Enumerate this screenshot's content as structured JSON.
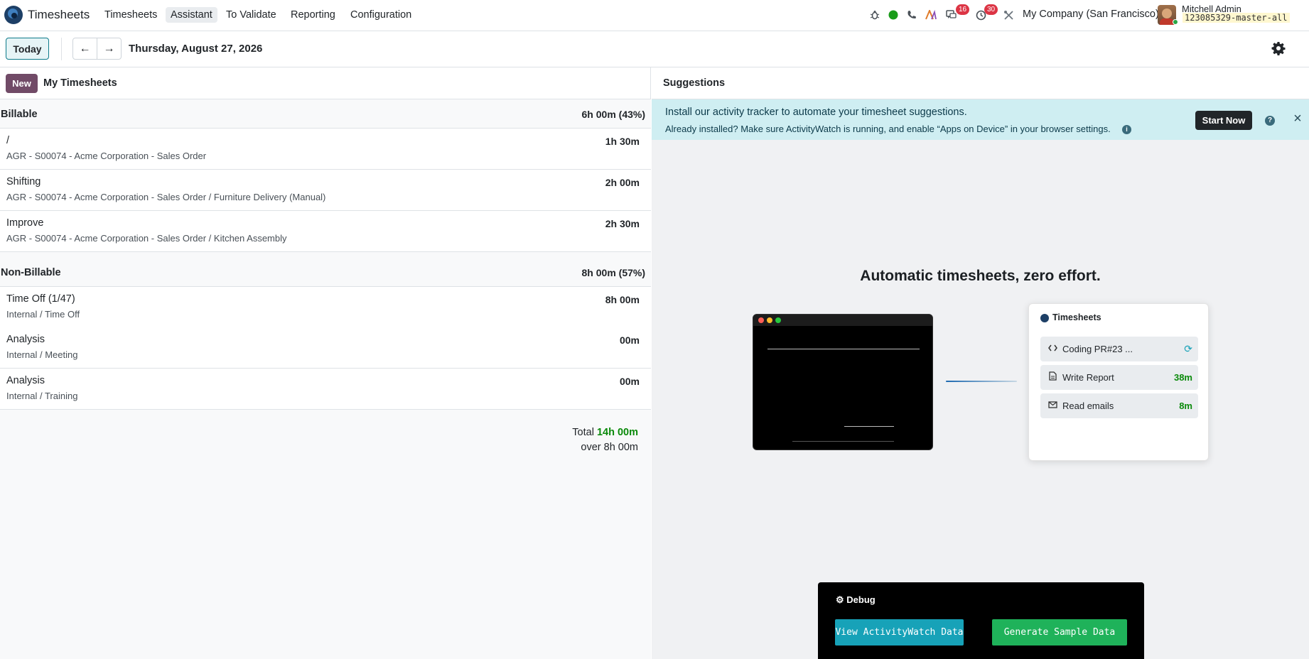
{
  "topbar": {
    "app_title": "Timesheets",
    "menu": [
      "Timesheets",
      "Assistant",
      "To Validate",
      "Reporting",
      "Configuration"
    ],
    "active_menu": "Assistant",
    "messages_count": "16",
    "activities_count": "30",
    "company": "My Company (San Francisco)",
    "user_name": "Mitchell Admin",
    "db_name": "123085329-master-all"
  },
  "controls": {
    "today_label": "Today",
    "prev_arrow": "←",
    "next_arrow": "→",
    "date": "Thursday, August 27, 2026"
  },
  "left": {
    "new_label": "New",
    "title": "My Timesheets",
    "groups": [
      {
        "label": "Billable",
        "total": "6h 00m (43%)",
        "rows": [
          {
            "title": "/",
            "sub": "AGR - S00074 - Acme Corporation - Sales Order",
            "time": "1h 30m"
          },
          {
            "title": "Shifting",
            "sub": "AGR - S00074 - Acme Corporation - Sales Order / Furniture Delivery (Manual)",
            "time": "2h 00m"
          },
          {
            "title": "Improve",
            "sub": "AGR - S00074 - Acme Corporation - Sales Order / Kitchen Assembly",
            "time": "2h 30m"
          }
        ]
      },
      {
        "label": "Non-Billable",
        "total": "8h 00m (57%)",
        "rows": [
          {
            "title": "Time Off (1/47)",
            "sub": "Internal / Time Off",
            "time": "8h 00m"
          },
          {
            "title": "Analysis",
            "sub": "Internal / Meeting",
            "time": "00m"
          },
          {
            "title": "Analysis",
            "sub": "Internal / Training",
            "time": "00m"
          }
        ]
      }
    ],
    "total_label": "Total",
    "total_value": "14h 00m",
    "over_label": "over 8h 00m"
  },
  "right": {
    "title": "Suggestions",
    "banner_line1": "Install our activity tracker to automate your timesheet suggestions.",
    "banner_line2": "Already installed? Make sure ActivityWatch is running, and enable “Apps on Device” in your browser settings.",
    "start_now": "Start Now",
    "hero": "Automatic timesheets, zero effort.",
    "card_title": "Timesheets",
    "card_items": [
      {
        "icon": "code-icon",
        "label": "Coding PR#23 ...",
        "value": ""
      },
      {
        "icon": "document-icon",
        "label": "Write Report",
        "value": "38m"
      },
      {
        "icon": "envelope-icon",
        "label": "Read emails",
        "value": "8m"
      }
    ],
    "debug_title": "Debug",
    "view_aw": "View ActivityWatch Data",
    "generate": "Generate Sample Data"
  },
  "colors": {
    "brand": "#714b67",
    "accent": "#17a2b8",
    "success": "#1fb25a",
    "badge": "#dc3545",
    "banner": "#cfeef2"
  }
}
